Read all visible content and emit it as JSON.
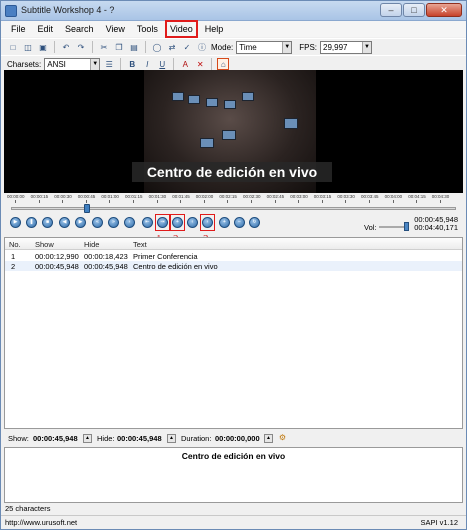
{
  "window": {
    "title": "Subtitle Workshop 4 - ?",
    "buttons": [
      "–",
      "□",
      "✕"
    ]
  },
  "menu": [
    "File",
    "Edit",
    "Search",
    "View",
    "Tools",
    "Video",
    "Help"
  ],
  "toolbar1": {
    "mode_label": "Mode:",
    "mode_value": "Time",
    "fps_label": "FPS:",
    "fps_value": "29,997"
  },
  "toolbar2": {
    "charsets_label": "Charsets:",
    "charset_value": "ANSI"
  },
  "video": {
    "subtitle": "Centro de edición en vivo"
  },
  "timeline": {
    "ticks": [
      "00:00:00",
      "00:00:15",
      "00:00:30",
      "00:00:45",
      "00:01:00",
      "00:01:15",
      "00:01:30",
      "00:01:45",
      "00:02:00",
      "00:02:15",
      "00:02:30",
      "00:02:45",
      "00:03:00",
      "00:03:15",
      "00:03:30",
      "00:03:45",
      "00:04:00",
      "00:04:15",
      "00:04:30"
    ]
  },
  "playback": {
    "current_time": "00:00:45,948",
    "total_time": "00:04:40,171",
    "vol_label": "Vol:",
    "annotations": [
      "1",
      "2",
      "3"
    ]
  },
  "list": {
    "columns": [
      "No.",
      "Show",
      "Hide",
      "Text"
    ],
    "rows": [
      {
        "no": "1",
        "show": "00:00:12,990",
        "hide": "00:00:18,423",
        "text": "Primer Conferencia"
      },
      {
        "no": "2",
        "show": "00:00:45,948",
        "hide": "00:00:45,948",
        "text": "Centro de edición en vivo"
      }
    ]
  },
  "edit": {
    "show_label": "Show:",
    "show_value": "00:00:45,948",
    "hide_label": "Hide:",
    "hide_value": "00:00:45,948",
    "duration_label": "Duration:",
    "duration_value": "00:00:00,000",
    "text": "Centro de edición en vivo"
  },
  "status": {
    "characters": "25 characters",
    "url": "http://www.urusoft.net",
    "sapi": "SAPI v1.12"
  }
}
